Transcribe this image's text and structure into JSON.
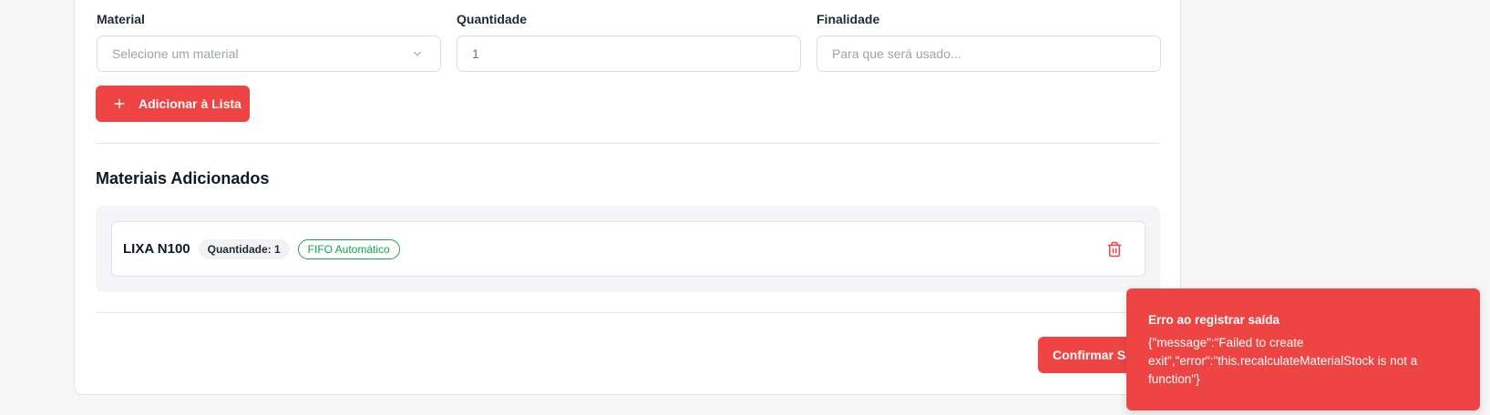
{
  "form": {
    "material_label": "Material",
    "material_placeholder": "Selecione um material",
    "quantity_label": "Quantidade",
    "quantity_value": "1",
    "purpose_label": "Finalidade",
    "purpose_placeholder": "Para que será usado...",
    "add_button_label": "Adicionar à Lista"
  },
  "added_section": {
    "title": "Materiais Adicionados",
    "items": [
      {
        "name": "LIXA N100",
        "quantity_badge": "Quantidade: 1",
        "fifo_badge": "FIFO Automático"
      }
    ]
  },
  "footer": {
    "confirm_button_label": "Confirmar Saída"
  },
  "toast": {
    "title": "Erro ao registrar saída",
    "message": "{\"message\":\"Failed to create exit\",\"error\":\"this.recalculateMaterialStock is not a function\"}"
  },
  "colors": {
    "accent": "#ef4444",
    "success": "#16a34a"
  }
}
